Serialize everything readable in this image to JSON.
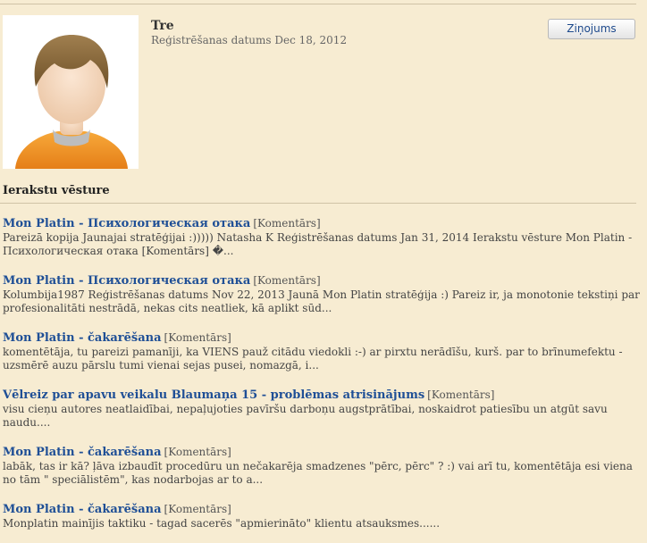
{
  "profile": {
    "username": "Tre",
    "registration": "Reģistrēšanas datums Dec 18, 2012",
    "message_button": "Ziņojums"
  },
  "history": {
    "title": "Ierakstu vēsture",
    "posts": [
      {
        "title": "Mon Platin - Психологическая отака",
        "type": "[Komentārs]",
        "excerpt": "Pareizā kopija Jaunajai stratēģijai :))))) Natasha K Reģistrēšanas datums Jan 31, 2014 Ierakstu vēsture Mon Platin - Психологическая отака [Komentārs] �..."
      },
      {
        "title": "Mon Platin - Психологическая отака",
        "type": "[Komentārs]",
        "excerpt": "Kolumbija1987 Reģistrēšanas datums Nov 22, 2013 Jaunā Mon Platin stratēģija :) Pareiz ir, ja monotonie tekstiņi par profesionalitāti nestrādā, nekas cits neatliek, kā aplikt sūd..."
      },
      {
        "title": "Mon Platin - čakarēšana",
        "type": "[Komentārs]",
        "excerpt": "komentētāja, tu pareizi pamanīji, ka VIENS pauž citādu viedokli :-) ar pirxtu nerādīšu, kurš. par to brīnumefektu - uzsmērē auzu pārslu tumi vienai sejas pusei, nomazgā, i..."
      },
      {
        "title": "Vēlreiz par apavu veikalu Blaumaņa 15 - problēmas atrisinājums",
        "type": "[Komentārs]",
        "excerpt": "visu cieņu autores neatlaidībai, nepaļujoties pavīršu darboņu augstprātībai, noskaidrot patiesību un atgūt savu naudu...."
      },
      {
        "title": "Mon Platin - čakarēšana",
        "type": "[Komentārs]",
        "excerpt": "labāk, tas ir kā? ļāva izbaudīt procedūru un nečakarēja smadzenes \"pērc, pērc\" ? :) vai arī tu, komentētāja esi viena no tām \" speciālistēm\", kas nodarbojas ar to a..."
      },
      {
        "title": "Mon Platin - čakarēšana",
        "type": "[Komentārs]",
        "excerpt": "Monplatin mainījis taktiku - tagad sacerēs \"apmierināto\" klientu atsauksmes......"
      }
    ]
  },
  "colors": {
    "background": "#f7ecd2",
    "link": "#1f4f96",
    "avatar_shirt": "#f09a2a",
    "avatar_hair": "#8a6a3c",
    "avatar_skin": "#f6dcc4"
  },
  "icons": {
    "avatar": "default-user-avatar"
  }
}
